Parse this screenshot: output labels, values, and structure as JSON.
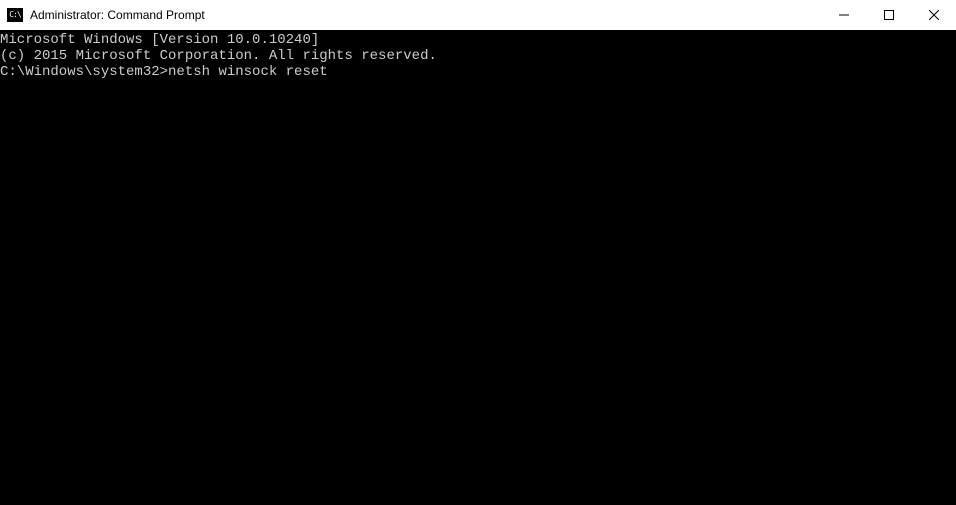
{
  "window": {
    "title": "Administrator: Command Prompt"
  },
  "terminal": {
    "line1": "Microsoft Windows [Version 10.0.10240]",
    "line2": "(c) 2015 Microsoft Corporation. All rights reserved.",
    "blank": "",
    "prompt": "C:\\Windows\\system32>",
    "command": "netsh winsock reset"
  }
}
